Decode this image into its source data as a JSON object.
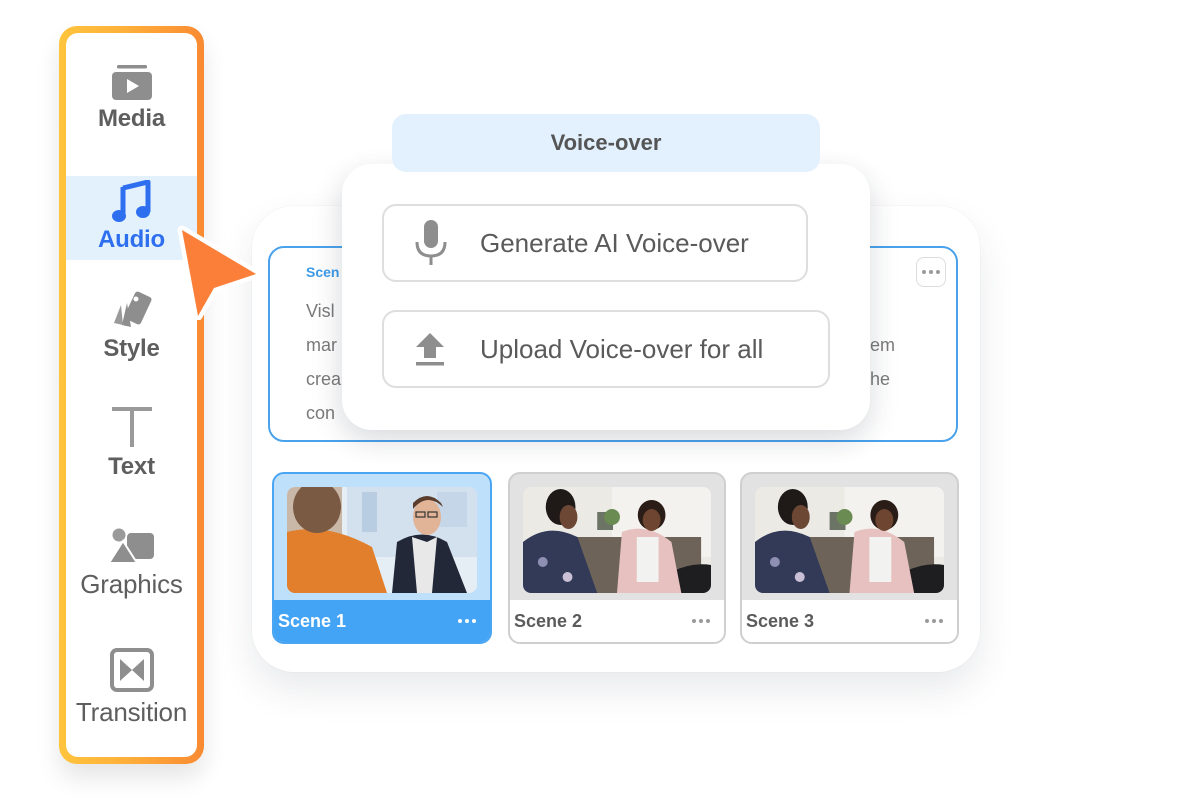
{
  "sidebar": {
    "items": [
      {
        "label": "Media",
        "icon": "media-play-icon",
        "active": false
      },
      {
        "label": "Audio",
        "icon": "music-note-icon",
        "active": true
      },
      {
        "label": "Style",
        "icon": "style-swatch-icon",
        "active": false
      },
      {
        "label": "Text",
        "icon": "text-t-icon",
        "active": false
      },
      {
        "label": "Graphics",
        "icon": "shapes-icon",
        "active": false
      },
      {
        "label": "Transition",
        "icon": "transition-bowtie-icon",
        "active": false
      }
    ],
    "accent_gradient": [
      "#ffc43d",
      "#f98a32"
    ],
    "active_color": "#2e6ff0"
  },
  "voiceover": {
    "title": "Voice-over",
    "options": [
      {
        "label": "Generate AI Voice-over",
        "icon": "microphone-icon"
      },
      {
        "label": "Upload Voice-over for all",
        "icon": "upload-icon"
      }
    ]
  },
  "script": {
    "scene_label": "Scen",
    "lines": [
      {
        "start": "Visl",
        "end": ""
      },
      {
        "start": "mar",
        "end": "em"
      },
      {
        "start": "crea",
        "end": "he"
      },
      {
        "start": "con",
        "end": ""
      }
    ],
    "more_icon": "more-horizontal-icon"
  },
  "scenes": [
    {
      "name": "Scene 1",
      "active": true
    },
    {
      "name": "Scene 2",
      "active": false
    },
    {
      "name": "Scene 3",
      "active": false
    }
  ],
  "colors": {
    "selection_blue": "#43a3f5",
    "cursor_orange": "#fb7f38",
    "tab_bg": "#e2f1fd"
  }
}
